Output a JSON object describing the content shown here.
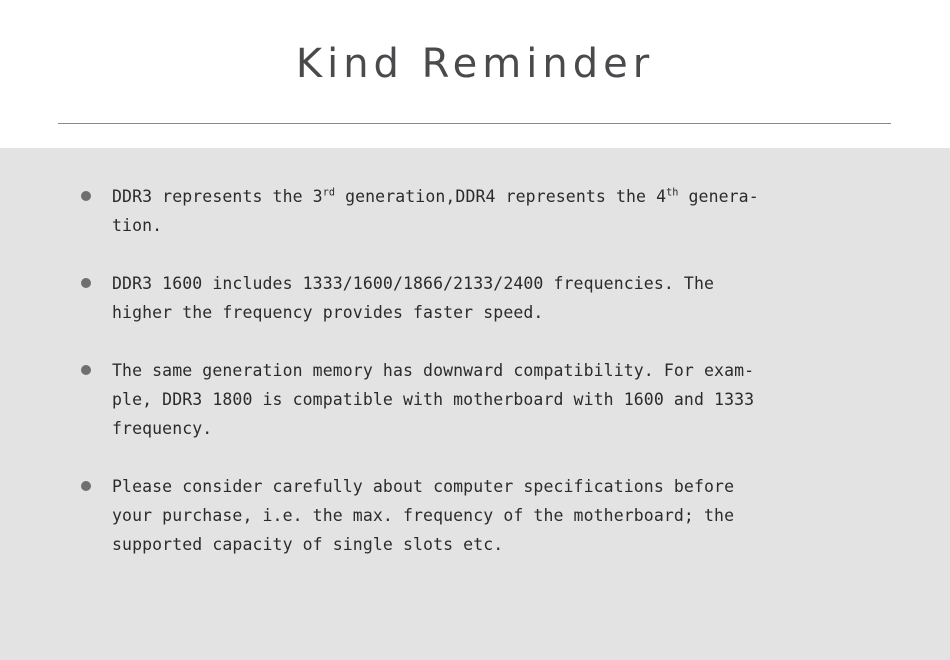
{
  "header": {
    "title": "Kind Reminder",
    "divider": "horizontal-rule"
  },
  "body": {
    "bullets": [
      {
        "marker": "bullet-dot",
        "segments": [
          {
            "type": "text",
            "value": "DDR3 represents the 3"
          },
          {
            "type": "sup",
            "value": "rd"
          },
          {
            "type": "text",
            "value": " generation,DDR4 represents the 4"
          },
          {
            "type": "sup",
            "value": "th"
          },
          {
            "type": "text",
            "value": " genera-\ntion."
          }
        ],
        "plain": "DDR3 represents the 3rd generation,DDR4 represents the 4th genera-tion."
      },
      {
        "marker": "bullet-dot",
        "segments": [
          {
            "type": "text",
            "value": "DDR3 1600 includes 1333/1600/1866/2133/2400 frequencies. The\nhigher the frequency provides faster speed."
          }
        ],
        "plain": "DDR3 1600 includes 1333/1600/1866/2133/2400 frequencies. The higher the frequency provides faster speed."
      },
      {
        "marker": "bullet-dot",
        "segments": [
          {
            "type": "text",
            "value": "The same generation memory has downward compatibility. For exam-\nple, DDR3 1800 is compatible with motherboard with 1600 and 1333\nfrequency."
          }
        ],
        "plain": "The same generation memory has downward compatibility. For example, DDR3 1800 is compatible with motherboard with 1600 and 1333 frequency."
      },
      {
        "marker": "bullet-dot",
        "segments": [
          {
            "type": "text",
            "value": "Please consider carefully about computer specifications before\nyour purchase, i.e. the max. frequency of the motherboard; the\nsupported capacity of single slots etc."
          }
        ],
        "plain": "Please consider carefully about computer specifications before your purchase, i.e. the max. frequency of the motherboard; the supported capacity of single slots etc."
      }
    ]
  },
  "colors": {
    "header_background": "#ffffff",
    "body_background": "#e3e3e3",
    "title_text": "#4a4a4d",
    "body_text": "#2b2b2b",
    "bullet_marker": "#6f6f72",
    "divider": "#8a8a8d"
  }
}
